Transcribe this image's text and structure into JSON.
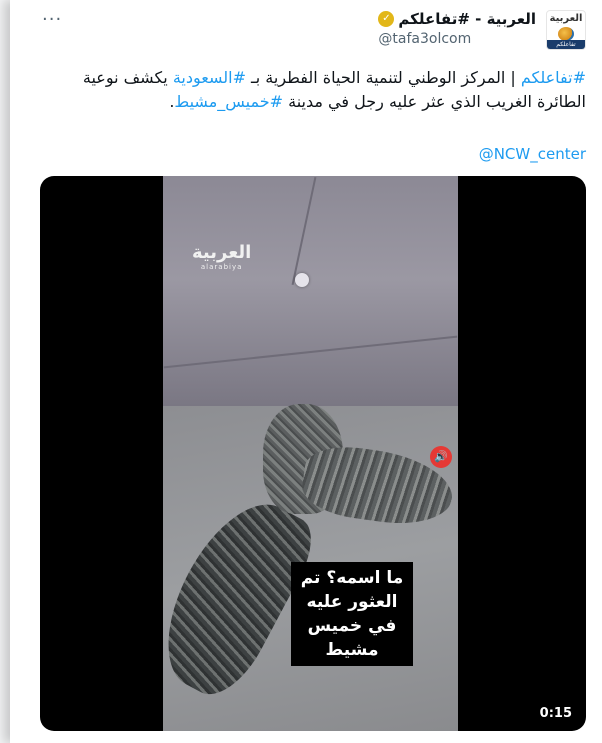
{
  "tweet": {
    "display_name": "العربية - #تفاعلكم",
    "handle": "@tafa3olcom",
    "more_label": "···",
    "avatar": {
      "brand": "العربية",
      "subtitle": "تفاعلكم"
    },
    "verified_badge_color": "#e2b719",
    "text_parts": [
      {
        "text": "#تفاعلكم",
        "tag": true
      },
      {
        "text": " | المركز الوطني لتنمية الحياة الفطرية بـ ",
        "tag": false
      },
      {
        "text": "#السعودية",
        "tag": true
      },
      {
        "text": " يكشف نوعية الطائرة الغريب الذي عثر عليه رجل في مدينة ",
        "tag": false
      },
      {
        "text": "#خميس_مشيط",
        "tag": true
      },
      {
        "text": ".",
        "tag": false
      }
    ],
    "mention": "@NCW_center"
  },
  "video": {
    "logo_arabic": "العربية",
    "logo_latin": "alarabiya",
    "caption": "ما اسمه؟ تم العثور عليه في خميس مشيط",
    "duration": "0:15",
    "sound_icon": "speaker-muted-icon"
  },
  "colors": {
    "link": "#1d9bf0",
    "text": "#0f1419",
    "muted": "#536471",
    "sound": "#e53935"
  }
}
